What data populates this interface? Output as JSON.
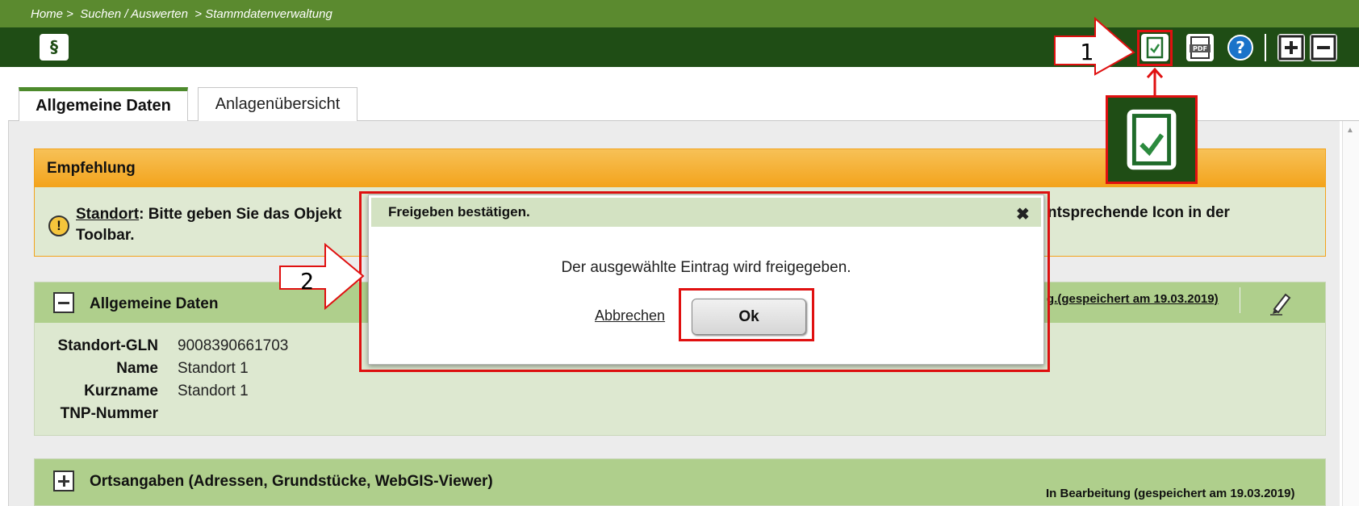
{
  "breadcrumb": "Home >  Suchen / Auswerten  > Stammdatenverwaltung",
  "toolbar": {
    "logo_label": "§",
    "icons": [
      "release-document-icon",
      "pdf-icon",
      "help-icon",
      "expand-all-icon",
      "collapse-all-icon"
    ]
  },
  "tabs": [
    {
      "label": "Allgemeine Daten",
      "active": true
    },
    {
      "label": "Anlagenübersicht",
      "active": false
    }
  ],
  "recommendation": {
    "title": "Empfehlung",
    "link": "Standort",
    "text_start": ": Bitte geben Sie das Objekt",
    "text_end": "ntsprechende Icon in der",
    "text_line2": "Toolbar."
  },
  "general_data": {
    "title": "Allgemeine Daten",
    "status": "g.(gespeichert am 19.03.2019)",
    "fields": [
      {
        "label": "Standort-GLN",
        "value": "9008390661703"
      },
      {
        "label": "Name",
        "value": "Standort 1"
      },
      {
        "label": "Kurzname",
        "value": "Standort 1"
      },
      {
        "label": "TNP-Nummer",
        "value": ""
      }
    ]
  },
  "locations": {
    "title": "Ortsangaben (Adressen, Grundstücke, WebGIS-Viewer)",
    "status": "In Bearbeitung (gespeichert am 19.03.2019)"
  },
  "dialog": {
    "title": "Freigeben bestätigen.",
    "message": "Der ausgewählte Eintrag wird freigegeben.",
    "cancel_label": "Abbrechen",
    "ok_label": "Ok"
  },
  "annotations": {
    "step1": "1",
    "step2": "2",
    "highlight_color": "#e01010"
  },
  "colors": {
    "header_green": "#5b8a2f",
    "toolbar_dark_green": "#1f4d15",
    "panel_green": "#afcf8c",
    "recommendation_orange": "#f3a31b"
  }
}
